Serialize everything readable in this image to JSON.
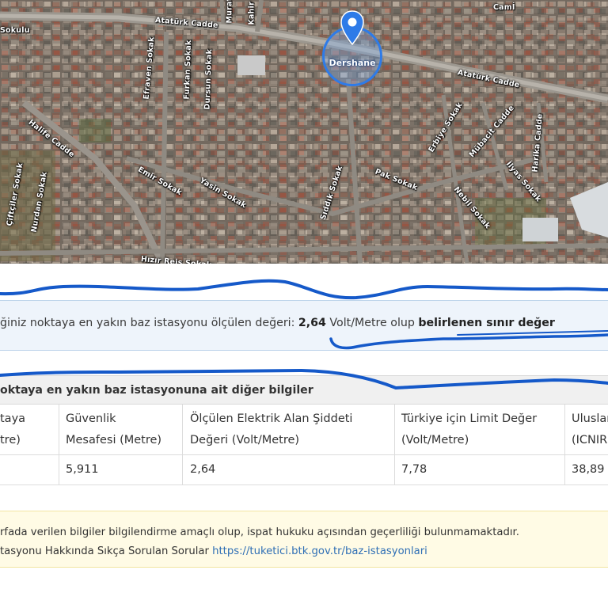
{
  "map": {
    "marker_label": "Dershane",
    "street_labels": [
      "Atatürk Cadde",
      "Atatürk Cadde",
      "Sokulu",
      "Camİ",
      "Murat",
      "Kahir",
      "Efraven Sokak",
      "Furkan Sokak",
      "Dursun Sokak",
      "Halife Cadde",
      "Emir Sokak",
      "Yasin Sokak",
      "Sıddık Sokak",
      "Pak Sokak",
      "Erbiye Sokak",
      "Mübacit Cadde",
      "Harika Cadde",
      "Nebil Sokak",
      "İlyas Sokak",
      "Çiftçiler Sokak",
      "Nurdan Sokak",
      "Hızır Reis Sokak"
    ],
    "colors": {
      "marker": "#2e7be8",
      "annotation": "#1559c9"
    }
  },
  "info": {
    "text_before": "ğiniz noktaya en yakın baz istasyonu ölçülen değeri: ",
    "value": "2,64",
    "text_middle": " Volt/Metre olup ",
    "text_bold_end": "belirlenen sınır değer"
  },
  "table": {
    "title": "oktaya en yakın baz istasyonuna ait diğer bilgiler",
    "headers": [
      [
        "taya",
        "tre)"
      ],
      [
        "Güvenlik",
        "Mesafesi (Metre)"
      ],
      [
        "Ölçülen Elektrik Alan Şiddeti",
        "Değeri (Volt/Metre)"
      ],
      [
        "Türkiye için Limit Değer",
        "(Volt/Metre)"
      ],
      [
        "Uluslararası",
        "(ICNIRP)"
      ]
    ],
    "row": [
      "",
      "5,911",
      "2,64",
      "7,78",
      "38,89"
    ]
  },
  "warning": {
    "line1": "rfada verilen bilgiler bilgilendirme amaçlı olup, ispat hukuku açısından geçerliliği bulunmamaktadır.",
    "line2_prefix": "tasyonu Hakkında Sıkça Sorulan Sorular ",
    "link": "https://tuketici.btk.gov.tr/baz-istasyonlari"
  }
}
